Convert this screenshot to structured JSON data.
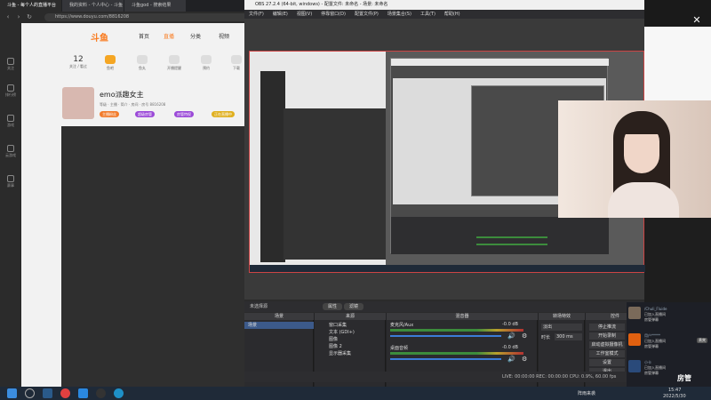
{
  "browser": {
    "tabs": [
      "斗鱼 - 每个人的直播平台",
      "我的资料 - 个人中心 - 斗鱼",
      "斗鱼god - 搜索结果"
    ],
    "url": "https://www.douyu.com/8816208",
    "rail": [
      "关注",
      "排行榜",
      "游戏",
      "云游戏",
      "赛事"
    ]
  },
  "site": {
    "logo": "斗鱼",
    "nav": [
      "首页",
      "直播",
      "分类",
      "视频"
    ],
    "icons": [
      {
        "top": "12",
        "label": "关注 / 看过"
      },
      {
        "top": "",
        "label": "鱼吧"
      },
      {
        "top": "",
        "label": "鱼丸"
      },
      {
        "top": "",
        "label": "开播提醒"
      },
      {
        "top": "",
        "label": "预约"
      },
      {
        "top": "",
        "label": "下载"
      }
    ],
    "profile": {
      "name": "emo派趣女主",
      "sub": "等级 · 主播 · 简介 · 房间 · 房号 8816208",
      "badges": [
        "主播粉丝",
        "超级房管",
        "房管特权",
        "正在直播中"
      ]
    }
  },
  "obs": {
    "title": "OBS 27.2.4 (64-bit, windows) - 配置文件: 未命名 - 场景: 未命名",
    "menu": [
      "文件(F)",
      "编辑(E)",
      "视图(V)",
      "停靠窗口(D)",
      "配置文件(P)",
      "场景集合(S)",
      "工具(T)",
      "帮助(H)"
    ],
    "preview_label": "未选择源",
    "controls": [
      "属性",
      "滤镜"
    ],
    "docks": {
      "scenes": {
        "title": "场景",
        "items": [
          "场景"
        ]
      },
      "sources": {
        "title": "来源",
        "items": [
          "窗口采集",
          "文本 (GDI+)",
          "图像",
          "图像 2",
          "显示器采集"
        ]
      },
      "mixer": {
        "title": "混音器",
        "rows": [
          {
            "name": "麦克风/Aux",
            "db": "-0.0 dB"
          },
          {
            "name": "桌面音频",
            "db": "-0.0 dB"
          }
        ]
      },
      "transitions": {
        "title": "转场特效",
        "type": "淡出",
        "duration_label": "时长",
        "duration": "300 ms"
      },
      "controls": {
        "title": "控件",
        "buttons": [
          "停止推流",
          "开始录制",
          "启动虚拟摄像机",
          "工作室模式",
          "设置",
          "退出"
        ]
      }
    },
    "status": "LIVE: 00:00:00   REC: 00:00:00   CPU: 0.9%, 60.00 fps"
  },
  "chat": [
    {
      "name": "/Chuli_Fluide",
      "line1": "已加入直播间",
      "line2": "房管弹幕"
    },
    {
      "name": "用户*****",
      "line1": "已加入直播间",
      "line2": "房管弹幕",
      "tag": "贵宾"
    },
    {
      "name": "小卡",
      "line1": "已加入直播间",
      "line2": "房管弹幕"
    }
  ],
  "stamp": "房管",
  "taskbar": {
    "weather": "阵雨来袭",
    "time": "15:47",
    "date": "2022/5/30"
  },
  "colors": {
    "accent": "#f97a1e",
    "obs_bg": "#2b2b2b",
    "taskbar": "#1f2a38"
  }
}
